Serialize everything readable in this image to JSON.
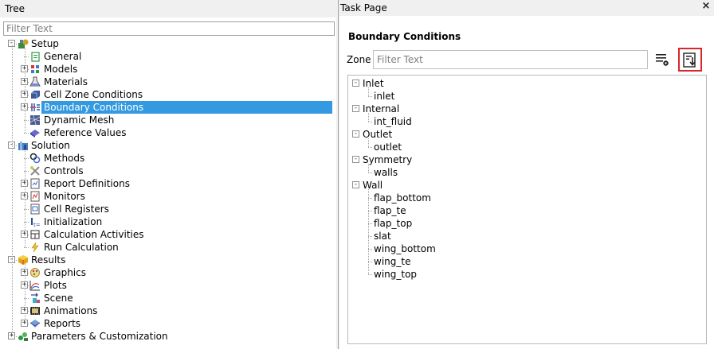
{
  "tree": {
    "header": "Tree",
    "filter_placeholder": "Filter Text",
    "items": [
      {
        "label": "Setup",
        "level": 0,
        "expander": "minus",
        "icon": "setup-icon"
      },
      {
        "label": "General",
        "level": 1,
        "expander": "none",
        "icon": "general-icon"
      },
      {
        "label": "Models",
        "level": 1,
        "expander": "plus",
        "icon": "models-icon"
      },
      {
        "label": "Materials",
        "level": 1,
        "expander": "plus",
        "icon": "materials-icon"
      },
      {
        "label": "Cell Zone Conditions",
        "level": 1,
        "expander": "plus",
        "icon": "cell-zone-icon"
      },
      {
        "label": "Boundary Conditions",
        "level": 1,
        "expander": "plus",
        "icon": "boundary-conditions-icon",
        "selected": true
      },
      {
        "label": "Dynamic Mesh",
        "level": 1,
        "expander": "none",
        "icon": "dynamic-mesh-icon"
      },
      {
        "label": "Reference Values",
        "level": 1,
        "expander": "none",
        "icon": "reference-values-icon"
      },
      {
        "label": "Solution",
        "level": 0,
        "expander": "minus",
        "icon": "solution-icon"
      },
      {
        "label": "Methods",
        "level": 1,
        "expander": "none",
        "icon": "methods-icon"
      },
      {
        "label": "Controls",
        "level": 1,
        "expander": "none",
        "icon": "controls-icon"
      },
      {
        "label": "Report Definitions",
        "level": 1,
        "expander": "plus",
        "icon": "report-definitions-icon"
      },
      {
        "label": "Monitors",
        "level": 1,
        "expander": "plus",
        "icon": "monitors-icon"
      },
      {
        "label": "Cell Registers",
        "level": 1,
        "expander": "none",
        "icon": "cell-registers-icon"
      },
      {
        "label": "Initialization",
        "level": 1,
        "expander": "none",
        "icon": "initialization-icon"
      },
      {
        "label": "Calculation Activities",
        "level": 1,
        "expander": "plus",
        "icon": "calculation-activities-icon"
      },
      {
        "label": "Run Calculation",
        "level": 1,
        "expander": "none",
        "icon": "run-calculation-icon"
      },
      {
        "label": "Results",
        "level": 0,
        "expander": "minus",
        "icon": "results-icon"
      },
      {
        "label": "Graphics",
        "level": 1,
        "expander": "plus",
        "icon": "graphics-icon"
      },
      {
        "label": "Plots",
        "level": 1,
        "expander": "plus",
        "icon": "plots-icon"
      },
      {
        "label": "Scene",
        "level": 1,
        "expander": "none",
        "icon": "scene-icon"
      },
      {
        "label": "Animations",
        "level": 1,
        "expander": "plus",
        "icon": "animations-icon"
      },
      {
        "label": "Reports",
        "level": 1,
        "expander": "plus",
        "icon": "reports-icon"
      },
      {
        "label": "Parameters & Customization",
        "level": 0,
        "expander": "plus",
        "icon": "parameters-icon"
      }
    ]
  },
  "task_page": {
    "header": "Task Page",
    "close_label": "×",
    "title": "Boundary Conditions",
    "zone_label": "Zone",
    "zone_filter_placeholder": "Filter Text",
    "zones": [
      {
        "group": "Inlet",
        "children": [
          "inlet"
        ]
      },
      {
        "group": "Internal",
        "children": [
          "int_fluid"
        ]
      },
      {
        "group": "Outlet",
        "children": [
          "outlet"
        ]
      },
      {
        "group": "Symmetry",
        "children": [
          "walls"
        ]
      },
      {
        "group": "Wall",
        "children": [
          "flap_bottom",
          "flap_te",
          "flap_top",
          "slat",
          "wing_bottom",
          "wing_te",
          "wing_top"
        ]
      }
    ]
  },
  "colors": {
    "selection": "#3399e0",
    "highlight_frame": "#d9262c"
  }
}
